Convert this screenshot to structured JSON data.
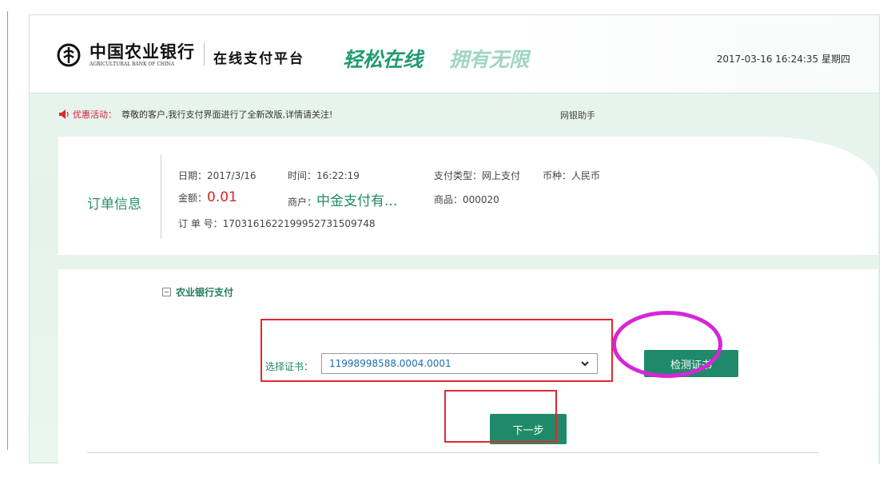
{
  "header": {
    "bank_name": "中国农业银行",
    "bank_name_en": "AGRICULTURAL BANK OF CHINA",
    "platform": "在线支付平台",
    "slogan_part1": "轻松在线",
    "slogan_part2": "拥有无限",
    "datetime": "2017-03-16 16:24:35 星期四"
  },
  "promo": {
    "label": "优惠活动：",
    "text": "尊敬的客户,我行支付界面进行了全新改版,详情请关注!",
    "helper": "网银助手"
  },
  "order": {
    "title": "订单信息",
    "date": "日期：2017/3/16",
    "time": "时间：16:22:19",
    "pay_type": "支付类型：网上支付",
    "currency": "币种：人民币",
    "amount_label": "金额：",
    "amount_value": "0.01",
    "merchant_label": "商户：",
    "merchant_value": "中金支付有...",
    "goods": "商品：000020",
    "order_no": "订 单 号：170316162219995273150974​8"
  },
  "payment": {
    "section_title": "农业银行支付",
    "cert_label": "选择证书：",
    "cert_value": "11998998588.0004.0001",
    "check_button": "检测证书",
    "next_button": "下一步"
  },
  "colors": {
    "accent": "#1f8a6a",
    "annotation_red": "#e2282d",
    "annotation_magenta": "#d627d6"
  }
}
